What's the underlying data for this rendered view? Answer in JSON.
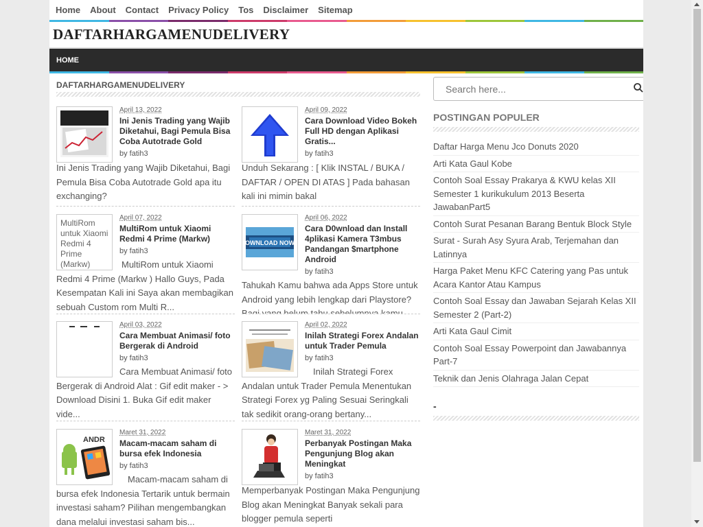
{
  "topnav": [
    "Home",
    "About",
    "Contact",
    "Privacy Policy",
    "Tos",
    "Disclaimer",
    "Sitemap"
  ],
  "brand": "DAFTARHARGAMENUDELIVERY",
  "mainnav": {
    "home": "HOME"
  },
  "content": {
    "section_title": "DAFTARHARGAMENUDELIVERY",
    "posts": [
      {
        "date": "April 13, 2022",
        "title": "Ini Jenis Trading yang Wajib Diketahui, Bagi Pemula Bisa Coba Autotrade Gold",
        "author": "by fatih3",
        "snippet": "Ini Jenis Trading yang Wajib Diketahui, Bagi Pemula Bisa Coba Autotrade Gold  apa itu exchanging?"
      },
      {
        "date": "April 09, 2022",
        "title": "Cara Download Video Bokeh Full HD dengan Aplikasi Gratis...",
        "author": "by fatih3",
        "snippet": "Unduh Sekarang :  [ Klik INSTAL / BUKA / DAFTAR / OPEN DI ATAS ] Pada bahasan kali ini mimin bakal"
      },
      {
        "date": "April 07, 2022",
        "title": "MultiRom untuk Xiaomi Redmi 4 Prime (Markw)",
        "author": "by fatih3",
        "snippet": "MultiRom untuk Xiaomi Redmi 4 Prime (Markw )  Hallo Guys, Pada Kesempatan Kali ini Saya akan membagikan sebuah Custom rom Multi R...",
        "thumb_alt": "MultiRom untuk Xiaomi Redmi 4 Prime (Markw)"
      },
      {
        "date": "April 06, 2022",
        "title": "Cara D0wnload dan Install 4plikasi Kamera T3mbus Pandangan $martphone Android",
        "author": "by fatih3",
        "snippet": "Tahukah Kamu bahwa ada Apps Store untuk Android yang lebih lengkap dari Playstore? Bagi yang belum tahu sebelumnya kamu bisa"
      },
      {
        "date": "April 03, 2022",
        "title": "Cara Membuat Animasi/ foto Bergerak di Android",
        "author": "by fatih3",
        "snippet": "Cara Membuat Animasi/ foto Bergerak di Android Alat : Gif edit maker  - > Download Disini                   1. Buka Gif edit maker vide..."
      },
      {
        "date": "April 02, 2022",
        "title": "Inilah Strategi Forex Andalan untuk Trader Pemula",
        "author": "by fatih3",
        "snippet": "Inilah Strategi Forex Andalan untuk Trader Pemula  Menentukan Strategi Forex yg Paling Sesuai  Seringkali tak sedikit orang-orang bertany..."
      },
      {
        "date": "Maret 31, 2022",
        "title": "Macam-macam saham di bursa efek Indonesia",
        "author": "by fatih3",
        "snippet": "Macam-macam saham di bursa efek Indonesia  Tertarik untuk bermain investasi saham? Pilihan mengembangkan dana melalui investasi saham bis..."
      },
      {
        "date": "Maret 31, 2022",
        "title": "Perbanyak Postingan Maka Pengunjung Blog akan Meningkat",
        "author": "by fatih3",
        "snippet": "Memperbanyak Postingan Maka Pengunjung Blog akan Meningkat Banyak sekali para blogger pemula seperti"
      }
    ]
  },
  "sidebar": {
    "search_placeholder": "Search here...",
    "popular_title": "POSTINGAN POPULER",
    "popular": [
      "Daftar Harga Menu Jco Donuts 2020",
      "Arti Kata Gaul Kobe",
      "Contoh Soal Essay Prakarya & KWU kelas XII Semester 1 kurikukulum 2013 Beserta JawabanPart5",
      "Contoh Surat Pesanan Barang Bentuk Block Style",
      "Surat - Surah Asy Syura Arab, Terjemahan dan Latinnya",
      "Harga Paket Menu KFC Catering yang Pas untuk Acara Kantor Atau Kampus",
      "Contoh Soal Essay dan Jawaban Sejarah Kelas XII Semester 2 (Part-2)",
      "Arti Kata Gaul Cimit",
      "Contoh Soal Essay Powerpoint dan Jawabannya Part-7",
      "Teknik dan Jenis Olahraga Jalan Cepat"
    ],
    "second_title": "-"
  },
  "colors": {
    "rainbow": [
      "#3fb7e3",
      "#8a4fa8",
      "#7a2b6b",
      "#cc3a6a",
      "#e85a8e",
      "#f29c38",
      "#f6c12e",
      "#9dc63a",
      "#3fb7e3",
      "#6fb04a"
    ]
  }
}
